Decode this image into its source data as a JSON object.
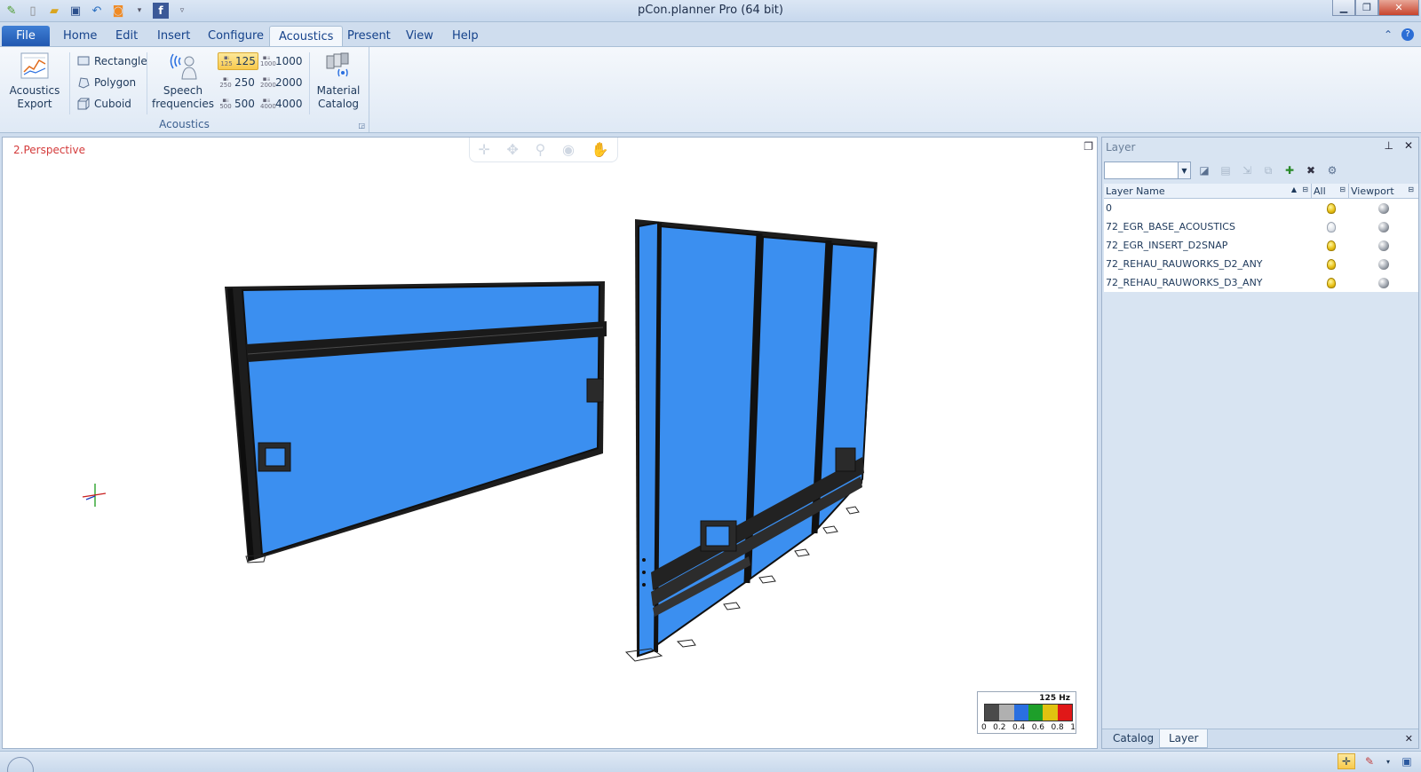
{
  "window": {
    "title": "pCon.planner Pro (64 bit)"
  },
  "quick_access": {
    "icons": [
      "app-logo-icon",
      "new-file-icon",
      "open-folder-icon",
      "save-icon",
      "undo-icon",
      "rss-icon",
      "facebook-icon",
      "customize-qat-icon"
    ]
  },
  "tabs": [
    {
      "label": "File",
      "state": "file"
    },
    {
      "label": "Home",
      "state": "normal"
    },
    {
      "label": "Edit",
      "state": "normal"
    },
    {
      "label": "Insert",
      "state": "normal"
    },
    {
      "label": "Configure",
      "state": "normal"
    },
    {
      "label": "Acoustics",
      "state": "active"
    },
    {
      "label": "Present",
      "state": "normal"
    },
    {
      "label": "View",
      "state": "normal"
    },
    {
      "label": "Help",
      "state": "normal"
    }
  ],
  "ribbon": {
    "acoustics_export": {
      "line1": "Acoustics",
      "line2": "Export"
    },
    "shapes": {
      "rectangle": "Rectangle",
      "polygon": "Polygon",
      "cuboid": "Cuboid"
    },
    "speech": {
      "line1": "Speech",
      "line2": "frequencies"
    },
    "frequencies": {
      "f125": "125",
      "f250": "250",
      "f500": "500",
      "f1000": "1000",
      "f2000": "2000",
      "f4000": "4000",
      "selected": "125"
    },
    "material_catalog": {
      "line1": "Material",
      "line2": "Catalog"
    },
    "group_label": "Acoustics"
  },
  "viewport": {
    "label": "2.Perspective",
    "legend": {
      "frequency": "125 Hz",
      "ticks": [
        "0",
        "0.2",
        "0.4",
        "0.6",
        "0.8",
        "1"
      ],
      "colors": [
        "#4a4a4a",
        "#b0b0b0",
        "#2a6fe0",
        "#1e9f2a",
        "#e0c210",
        "#e01818"
      ]
    },
    "panel_fill_color": "#3b8ff0"
  },
  "layer_panel": {
    "title": "Layer",
    "columns": {
      "name": "Layer Name",
      "all": "All",
      "viewport": "Viewport"
    },
    "rows": [
      {
        "name": "0",
        "all": "on",
        "viewport": "visible"
      },
      {
        "name": "72_EGR_BASE_ACOUSTICS",
        "all": "off",
        "viewport": "visible"
      },
      {
        "name": "72_EGR_INSERT_D2SNAP",
        "all": "on",
        "viewport": "visible"
      },
      {
        "name": "72_REHAU_RAUWORKS_D2_ANY",
        "all": "on",
        "viewport": "visible"
      },
      {
        "name": "72_REHAU_RAUWORKS_D3_ANY",
        "all": "on",
        "viewport": "visible"
      }
    ],
    "bottom_tabs": {
      "catalog": "Catalog",
      "layer": "Layer"
    }
  }
}
